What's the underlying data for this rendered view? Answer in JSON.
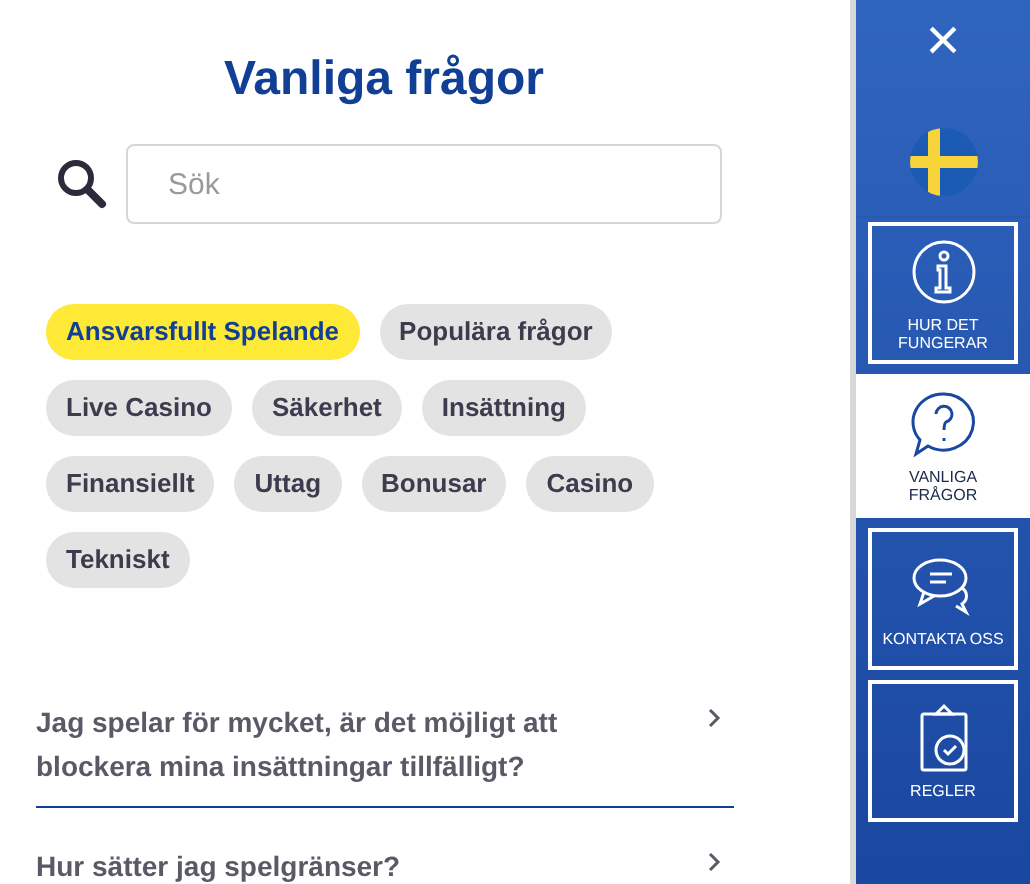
{
  "title": "Vanliga frågor",
  "search": {
    "placeholder": "Sök"
  },
  "categories": [
    {
      "label": "Ansvarsfullt Spelande",
      "selected": true
    },
    {
      "label": "Populära frågor",
      "selected": false
    },
    {
      "label": "Live Casino",
      "selected": false
    },
    {
      "label": "Säkerhet",
      "selected": false
    },
    {
      "label": "Insättning",
      "selected": false
    },
    {
      "label": "Finansiellt",
      "selected": false
    },
    {
      "label": "Uttag",
      "selected": false
    },
    {
      "label": "Bonusar",
      "selected": false
    },
    {
      "label": "Casino",
      "selected": false
    },
    {
      "label": "Tekniskt",
      "selected": false
    }
  ],
  "questions": [
    "Jag spelar för mycket, är det möjligt att blockera mina insättningar tillfälligt?",
    "Hur sätter jag spelgränser?"
  ],
  "sidebar": {
    "close": "×",
    "items": [
      {
        "kind": "info",
        "label": "HUR DET FUNGERAR",
        "selected": false
      },
      {
        "kind": "question",
        "label": "VANLIGA FRÅGOR",
        "selected": true
      },
      {
        "kind": "chat",
        "label": "KONTAKTA OSS",
        "selected": false
      },
      {
        "kind": "rules",
        "label": "REGLER",
        "selected": false
      }
    ]
  }
}
